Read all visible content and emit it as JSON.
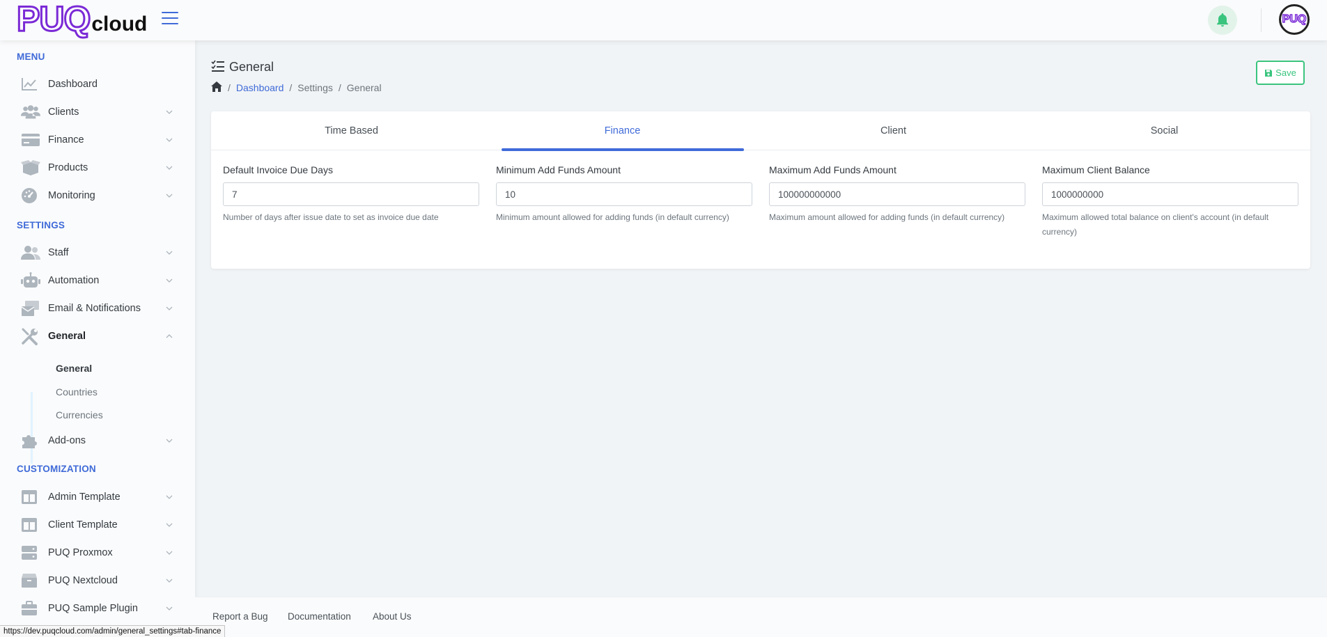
{
  "header": {
    "logo_main": "PUQ",
    "logo_sub": "cloud",
    "avatar_text": "PUQ"
  },
  "sidebar": {
    "sections": {
      "menu": "MENU",
      "settings": "SETTINGS",
      "customization": "CUSTOMIZATION"
    },
    "items": {
      "dashboard": "Dashboard",
      "clients": "Clients",
      "finance": "Finance",
      "products": "Products",
      "monitoring": "Monitoring",
      "staff": "Staff",
      "automation": "Automation",
      "email": "Email & Notifications",
      "general": "General",
      "addons": "Add-ons",
      "admin_template": "Admin Template",
      "client_template": "Client Template",
      "puq_proxmox": "PUQ Proxmox",
      "puq_nextcloud": "PUQ Nextcloud",
      "puq_sample": "PUQ Sample Plugin"
    },
    "submenu": {
      "general": "General",
      "countries": "Countries",
      "currencies": "Currencies"
    }
  },
  "page": {
    "title": "General",
    "breadcrumb": {
      "dashboard": "Dashboard",
      "settings": "Settings",
      "current": "General"
    },
    "save_label": "Save"
  },
  "tabs": {
    "time_based": "Time Based",
    "finance": "Finance",
    "client": "Client",
    "social": "Social"
  },
  "fields": {
    "due_days": {
      "label": "Default Invoice Due Days",
      "value": "7",
      "help": "Number of days after issue date to set as invoice due date"
    },
    "min_funds": {
      "label": "Minimum Add Funds Amount",
      "value": "10",
      "help": "Minimum amount allowed for adding funds (in default currency)"
    },
    "max_funds": {
      "label": "Maximum Add Funds Amount",
      "value": "100000000000",
      "help": "Maximum amount allowed for adding funds (in default currency)"
    },
    "max_balance": {
      "label": "Maximum Client Balance",
      "value": "1000000000",
      "help": "Maximum allowed total balance on client's account (in default currency)"
    }
  },
  "footer": {
    "report_bug": "Report a Bug",
    "documentation": "Documentation",
    "about": "About Us"
  },
  "status_url": "https://dev.puqcloud.com/admin/general_settings#tab-finance",
  "colors": {
    "primary": "#3f6ad8",
    "success": "#3ac47d",
    "brand": "#7a2ad6"
  }
}
